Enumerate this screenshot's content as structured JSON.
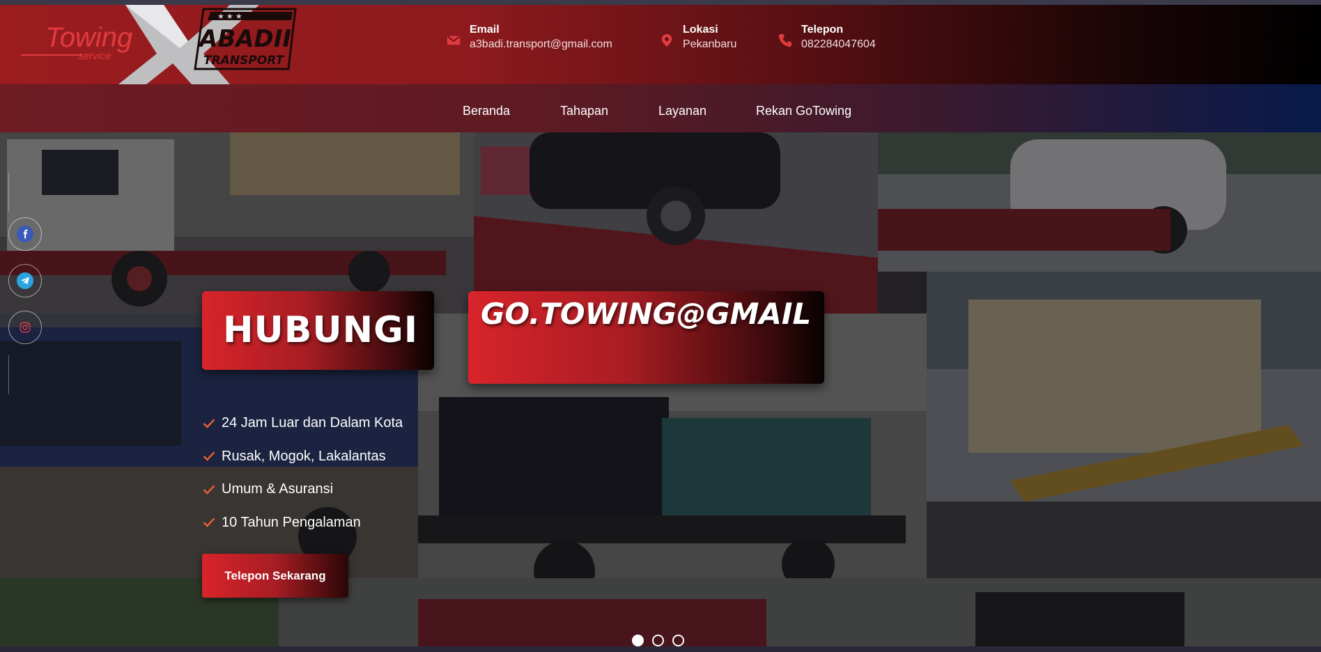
{
  "header": {
    "logo": {
      "brand_left": "Towing",
      "brand_sub": "service",
      "brand_right": "ABADII",
      "brand_right_sub": "TRANSPORT"
    },
    "contacts": [
      {
        "icon": "envelope-icon",
        "label": "Email",
        "value": "a3badi.transport@gmail.com"
      },
      {
        "icon": "map-pin-icon",
        "label": "Lokasi",
        "value": "Pekanbaru"
      },
      {
        "icon": "phone-icon",
        "label": "Telepon",
        "value": "082284047604"
      }
    ]
  },
  "nav": {
    "items": [
      {
        "label": "Beranda"
      },
      {
        "label": "Tahapan"
      },
      {
        "label": "Layanan"
      },
      {
        "label": "Rekan GoTowing"
      }
    ]
  },
  "social": [
    {
      "icon": "facebook-icon",
      "color": "#3b5ab8"
    },
    {
      "icon": "telegram-icon",
      "color": "#2aa3e0"
    },
    {
      "icon": "instagram-icon",
      "color": "#d33b4b"
    }
  ],
  "hero": {
    "headline": "HUBUNGI",
    "email_banner": "GO.TOWING@GMAIL",
    "features": [
      "24 Jam Luar dan Dalam Kota",
      "Rusak, Mogok, Lakalantas",
      "Umum & Asuransi",
      "10 Tahun Pengalaman"
    ],
    "cta_label": "Telepon Sekarang",
    "slides": 3,
    "active_slide": 1
  },
  "colors": {
    "accent": "#d8242a",
    "check": "#e8612c"
  }
}
